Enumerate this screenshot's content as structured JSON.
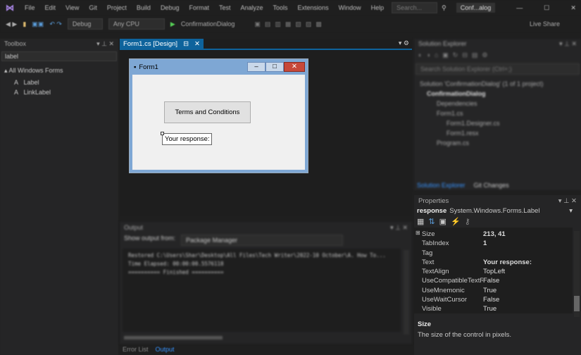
{
  "menu": [
    "File",
    "Edit",
    "View",
    "Git",
    "Project",
    "Build",
    "Debug",
    "Format",
    "Test",
    "Analyze",
    "Tools",
    "Extensions",
    "Window",
    "Help"
  ],
  "search_placeholder": "Search...",
  "window_title": "Conf...alog",
  "toolbar": {
    "config": "Debug",
    "platform": "Any CPU",
    "start": "ConfirmationDialog",
    "live_share": "Live Share"
  },
  "toolbox": {
    "title": "Toolbox",
    "search": "label",
    "group": "All Windows Forms",
    "items": [
      "Label",
      "LinkLabel"
    ]
  },
  "designer": {
    "tab": "Form1.cs [Design]",
    "form_title": "Form1",
    "button": "Terms and Conditions",
    "label": "Your response:"
  },
  "output": {
    "title": "Output",
    "show_from_label": "Show output from:",
    "source": "Package Manager",
    "lines": [
      "Restored C:\\Users\\Shar\\Desktop\\All Files\\Tech Writer\\2022-10 October\\A. How To...",
      "Time Elapsed: 00:00:00.5576118",
      "========== Finished =========="
    ]
  },
  "bottom_tabs": [
    "Error List",
    "Output"
  ],
  "solution_explorer": {
    "title": "Solution Explorer",
    "search": "Search Solution Explorer (Ctrl+;)",
    "tree": [
      "Solution 'ConfirmationDialog' (1 of 1 project)",
      "ConfirmationDialog",
      "Dependencies",
      "Form1.cs",
      "Form1.Designer.cs",
      "Form1.resx",
      "Program.cs"
    ],
    "tabs": [
      "Solution Explorer",
      "Git Changes"
    ]
  },
  "properties": {
    "title": "Properties",
    "object": "response",
    "type": "System.Windows.Forms.Label",
    "rows": [
      {
        "k": "Size",
        "v": "213, 41"
      },
      {
        "k": "TabIndex",
        "v": "1"
      },
      {
        "k": "Tag",
        "v": ""
      },
      {
        "k": "Text",
        "v": "Your response:"
      },
      {
        "k": "TextAlign",
        "v": "TopLeft"
      },
      {
        "k": "UseCompatibleTextRendering",
        "v": "False"
      },
      {
        "k": "UseMnemonic",
        "v": "True"
      },
      {
        "k": "UseWaitCursor",
        "v": "False"
      },
      {
        "k": "Visible",
        "v": "True"
      }
    ],
    "desc_title": "Size",
    "desc": "The size of the control in pixels."
  }
}
